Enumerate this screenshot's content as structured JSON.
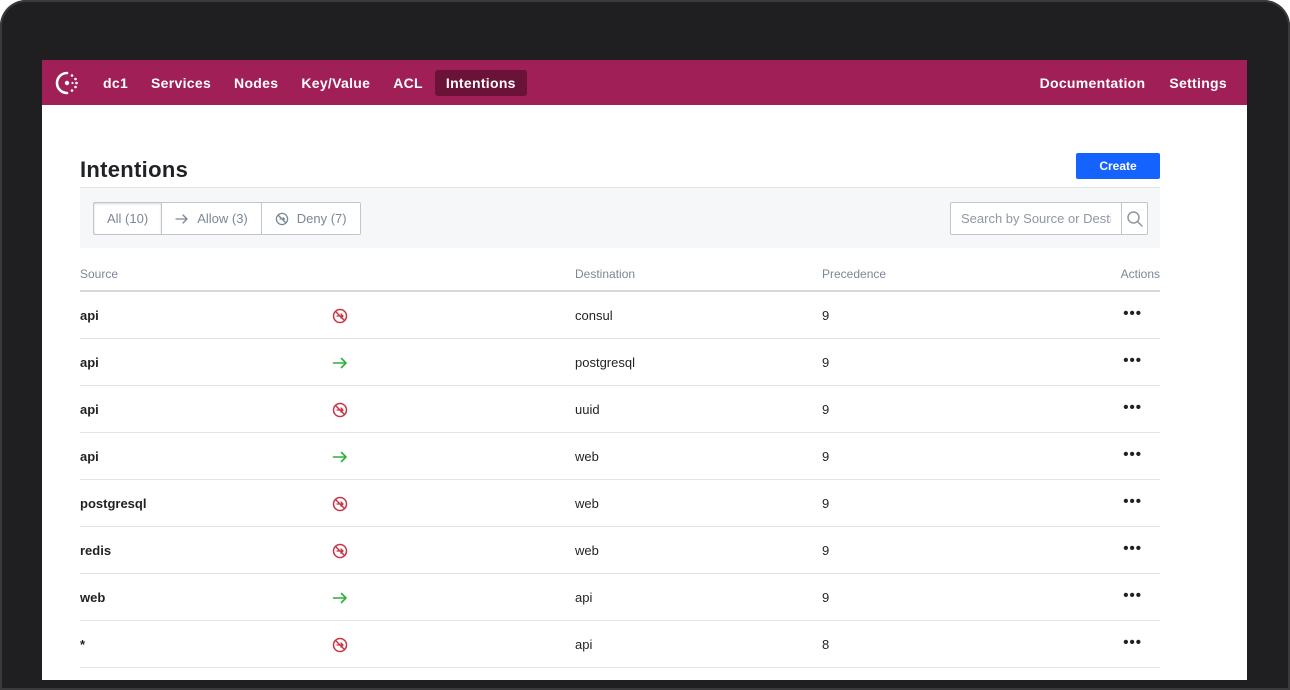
{
  "nav": {
    "datacenter": "dc1",
    "items": [
      "Services",
      "Nodes",
      "Key/Value",
      "ACL",
      "Intentions"
    ],
    "active": "Intentions",
    "right_items": [
      "Documentation",
      "Settings"
    ],
    "brand_color": "#a01f56",
    "active_color": "#6b1239"
  },
  "page": {
    "title": "Intentions",
    "create_label": "Create",
    "create_color": "#1563ff"
  },
  "filters": {
    "all": "All (10)",
    "allow": "Allow (3)",
    "deny": "Deny (7)",
    "active": "all"
  },
  "search": {
    "placeholder": "Search by Source or Destination",
    "icon": "search-icon"
  },
  "table": {
    "headers": {
      "source": "Source",
      "destination": "Destination",
      "precedence": "Precedence",
      "actions": "Actions"
    },
    "rows": [
      {
        "source": "api",
        "action": "deny",
        "destination": "consul",
        "precedence": "9"
      },
      {
        "source": "api",
        "action": "allow",
        "destination": "postgresql",
        "precedence": "9"
      },
      {
        "source": "api",
        "action": "deny",
        "destination": "uuid",
        "precedence": "9"
      },
      {
        "source": "api",
        "action": "allow",
        "destination": "web",
        "precedence": "9"
      },
      {
        "source": "postgresql",
        "action": "deny",
        "destination": "web",
        "precedence": "9"
      },
      {
        "source": "redis",
        "action": "deny",
        "destination": "web",
        "precedence": "9"
      },
      {
        "source": "web",
        "action": "allow",
        "destination": "api",
        "precedence": "9"
      },
      {
        "source": "*",
        "action": "deny",
        "destination": "api",
        "precedence": "8"
      }
    ],
    "more_label": "•••",
    "allow_color": "#2eb039",
    "deny_color": "#c73445"
  }
}
